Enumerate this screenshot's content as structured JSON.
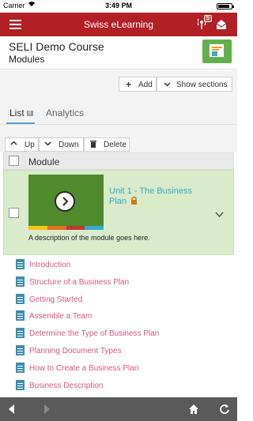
{
  "status_bar": {
    "carrier": "Carrier",
    "time": "3:49 PM",
    "battery_level": 0.9
  },
  "topbar": {
    "title": "Swiss eLearning",
    "notification_count": "5"
  },
  "course": {
    "title": "SELI Demo Course",
    "section": "Modules"
  },
  "toolbar": {
    "add_label": "Add",
    "show_sections_label": "Show sections"
  },
  "tabs": [
    {
      "label": "List",
      "count": "8"
    },
    {
      "label": "Analytics"
    }
  ],
  "actions": {
    "up_label": "Up",
    "down_label": "Down",
    "delete_label": "Delete"
  },
  "module_table": {
    "header_label": "Module"
  },
  "module": {
    "title": "Unit 1 - The Business Plan",
    "description": "A description of the module goes here.",
    "image_bar_colors": [
      "#f0c419",
      "#e07020",
      "#c0392b",
      "#3aa9c9"
    ]
  },
  "lessons": [
    "Introduction",
    "Structure of a Business Plan",
    "Getting Started",
    "Assemble a Team",
    "Determine the Type of Business Plan",
    "Planning Document Types",
    "How to Create a Business Plan",
    "Business Description"
  ],
  "colors": {
    "brand": "#b21f24",
    "module_highlight": "#d9ebcb",
    "lesson_link": "#d6578a",
    "unit_link": "#3aa9c9"
  }
}
